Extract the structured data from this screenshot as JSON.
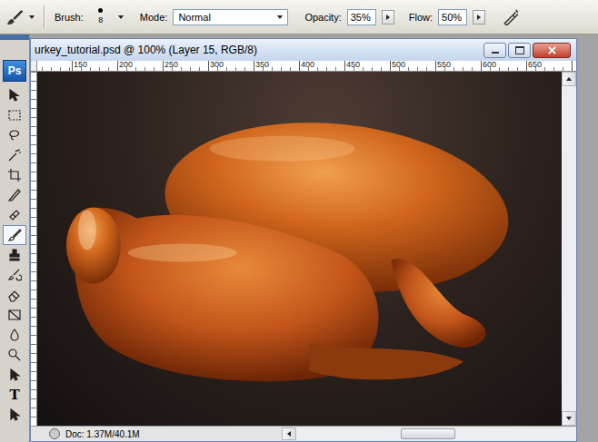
{
  "optionsBar": {
    "brushLabel": "Brush:",
    "brushSize": "8",
    "modeLabel": "Mode:",
    "mode": "Normal",
    "opacityLabel": "Opacity:",
    "opacity": "35%",
    "flowLabel": "Flow:",
    "flow": "50%",
    "airbrush": false
  },
  "toolbox": {
    "logo": "Ps",
    "tools": [
      {
        "kind": "move",
        "selected": false
      },
      {
        "kind": "marquee",
        "selected": false
      },
      {
        "kind": "lasso",
        "selected": false
      },
      {
        "kind": "wand",
        "selected": false
      },
      {
        "kind": "crop",
        "selected": false
      },
      {
        "kind": "slice",
        "selected": false
      },
      {
        "kind": "heal",
        "selected": false
      },
      {
        "kind": "brush",
        "selected": true
      },
      {
        "kind": "stamp",
        "selected": false
      },
      {
        "kind": "history",
        "selected": false
      },
      {
        "kind": "eraser",
        "selected": false
      },
      {
        "kind": "gradient",
        "selected": false
      },
      {
        "kind": "blur",
        "selected": false
      },
      {
        "kind": "dodge",
        "selected": false
      },
      {
        "kind": "path",
        "selected": false
      },
      {
        "kind": "type",
        "glyph": "T",
        "selected": false
      },
      {
        "kind": "direct",
        "selected": false
      }
    ]
  },
  "document": {
    "title": "urkey_tutorial.psd @ 100% (Layer 15, RGB/8)",
    "ruler": [
      "150",
      "200",
      "250",
      "300",
      "350",
      "400",
      "450",
      "500",
      "550",
      "600",
      "650"
    ],
    "status": "Doc: 1.37M/40.1M"
  }
}
